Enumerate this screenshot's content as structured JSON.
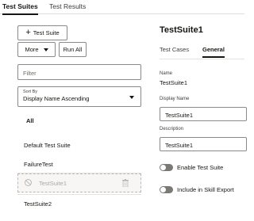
{
  "tabs": [
    {
      "label": "Test Suites",
      "active": true
    },
    {
      "label": "Test Results",
      "active": false
    }
  ],
  "toolbar": {
    "add_label": "Test Suite",
    "more_label": "More",
    "run_all_label": "Run All"
  },
  "filter": {
    "placeholder": "Filter"
  },
  "sort": {
    "label": "Sort By",
    "value": "Display Name Ascending"
  },
  "list": {
    "items": [
      {
        "label": "All",
        "bold": true
      },
      {
        "label": "Default Test Suite"
      },
      {
        "label": "FailureTest"
      },
      {
        "label": "TestSuite1",
        "disabled": true,
        "selected": true
      },
      {
        "label": "TestSuite2"
      }
    ]
  },
  "detail": {
    "title": "TestSuite1",
    "tabs": [
      {
        "label": "Test Cases",
        "active": false
      },
      {
        "label": "General",
        "active": true
      }
    ],
    "name_label": "Name",
    "name_value": "TestSuite1",
    "display_name_label": "Display Name",
    "display_name_value": "TestSuite1",
    "description_label": "Description",
    "description_value": "TestSuite1",
    "enable_label": "Enable Test Suite",
    "skill_export_label": "Include in Skill Export"
  },
  "colors": {
    "accent": "#161513",
    "toggle_off": "#7a7975",
    "border": "#8b8a88"
  }
}
